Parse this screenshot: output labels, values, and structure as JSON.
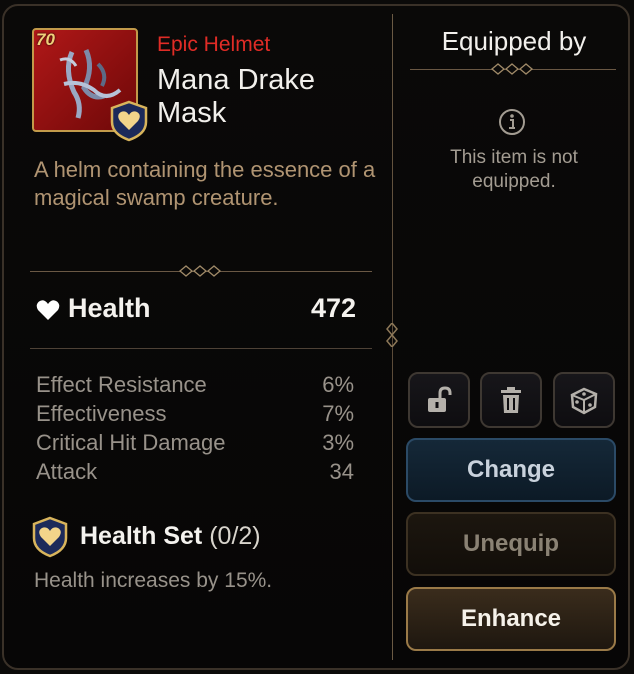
{
  "item": {
    "level": "70",
    "rarity": "Epic Helmet",
    "name": "Mana Drake Mask",
    "description": "A helm containing the essence of a magical swamp creature."
  },
  "main_stat": {
    "label": "Health",
    "value": "472",
    "icon": "heart-icon"
  },
  "substats": [
    {
      "label": "Effect Resistance",
      "value": "6%"
    },
    {
      "label": "Effectiveness",
      "value": "7%"
    },
    {
      "label": "Critical Hit Damage",
      "value": "3%"
    },
    {
      "label": "Attack",
      "value": "34"
    }
  ],
  "set": {
    "name": "Health Set",
    "count": "(0/2)",
    "description": "Health increases by 15%.",
    "icon": "health-set-icon"
  },
  "equipped": {
    "title": "Equipped by",
    "message": "This item is not equipped.",
    "icon": "info-icon"
  },
  "actions": {
    "lock_icon": "unlock-icon",
    "delete_icon": "trash-icon",
    "random_icon": "dice-icon",
    "change_label": "Change",
    "unequip_label": "Unequip",
    "enhance_label": "Enhance"
  },
  "colors": {
    "rarity": "#e02c26",
    "item_bg": "#b01818",
    "accent_gold": "#c29a4a",
    "description": "#b09472",
    "change_button": "#152838"
  }
}
